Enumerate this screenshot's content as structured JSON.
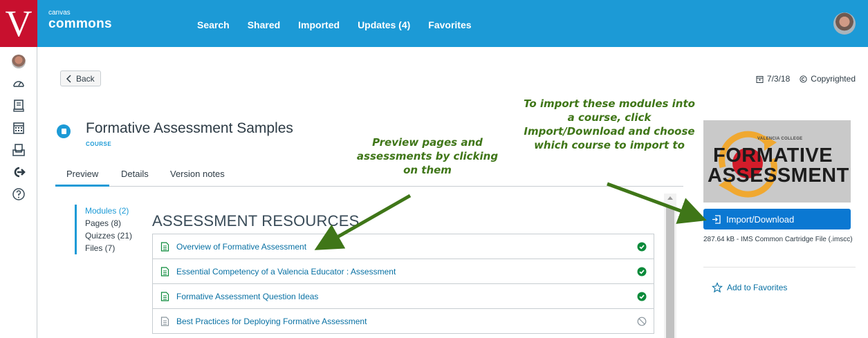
{
  "brand": {
    "small": "canvas",
    "big": "commons"
  },
  "topnav": [
    "Search",
    "Shared",
    "Imported",
    "Updates (4)",
    "Favorites"
  ],
  "back_label": "Back",
  "meta": {
    "date": "7/3/18",
    "license": "Copyrighted"
  },
  "course": {
    "title": "Formative Assessment Samples",
    "type": "COURSE"
  },
  "tabs": [
    "Preview",
    "Details",
    "Version notes"
  ],
  "side_list": [
    "Modules (2)",
    "Pages (8)",
    "Quizzes (21)",
    "Files (7)"
  ],
  "section_title": "ASSESSMENT RESOURCES",
  "resources": [
    {
      "label": "Overview of Formative Assessment",
      "status": "complete"
    },
    {
      "label": "Essential Competency of a Valencia Educator : Assessment",
      "status": "complete"
    },
    {
      "label": "Formative Assessment Question Ideas",
      "status": "complete"
    },
    {
      "label": "Best Practices for Deploying Formative Assessment",
      "status": "unavailable"
    }
  ],
  "thumbnail": {
    "small": "VALENCIA COLLEGE",
    "line1": "FORMATIVE",
    "line2": "ASSESSMENT"
  },
  "import_label": "Import/Download",
  "file_info": "287.64 kB - IMS Common Cartridge File (.imscc)",
  "favorites_label": "Add to Favorites",
  "annotations": {
    "preview_tip": "Preview pages and assessments by clicking on them",
    "import_tip": "To import these modules into a course, click Import/Download and choose which course to import to"
  },
  "colors": {
    "topbar": "#1c9ad6",
    "logo": "#c8102e",
    "annotation": "#3f7618",
    "import_button": "#0b78d2",
    "check": "#0b8a3a"
  }
}
